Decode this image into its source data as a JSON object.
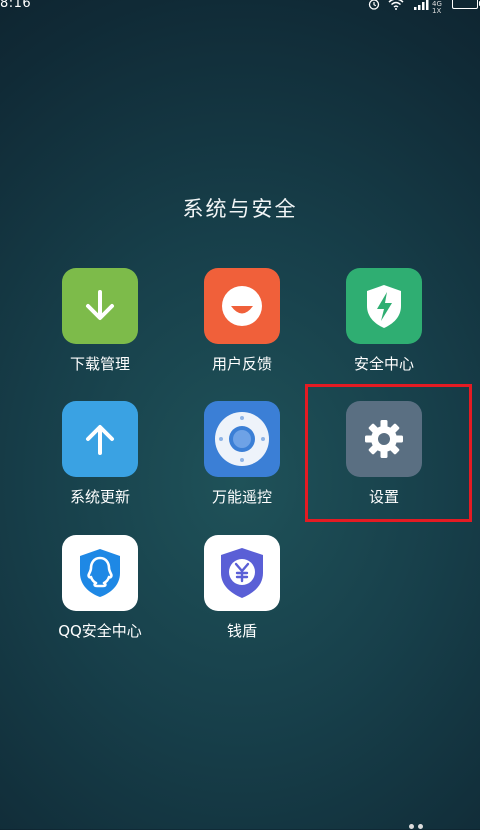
{
  "status_bar": {
    "time": "8:16",
    "network_label": "4G",
    "sim_label": "1X"
  },
  "folder": {
    "title": "系统与安全"
  },
  "apps": [
    {
      "label": "下载管理",
      "icon": "download-icon",
      "color": "#7dbb4a"
    },
    {
      "label": "用户反馈",
      "icon": "smiley-icon",
      "color": "#f0603a"
    },
    {
      "label": "安全中心",
      "icon": "shield-bolt-icon",
      "color": "#2fae72"
    },
    {
      "label": "系统更新",
      "icon": "arrow-up-icon",
      "color": "#3aa2e3"
    },
    {
      "label": "万能遥控",
      "icon": "remote-icon",
      "color": "#3b7fd6"
    },
    {
      "label": "设置",
      "icon": "gear-icon",
      "color": "#5a6f82"
    },
    {
      "label": "QQ安全中心",
      "icon": "qq-shield-icon",
      "color": "#ffffff"
    },
    {
      "label": "钱盾",
      "icon": "yuan-shield-icon",
      "color": "#ffffff"
    }
  ],
  "highlight": {
    "target": "设置",
    "color": "#e41b23"
  }
}
